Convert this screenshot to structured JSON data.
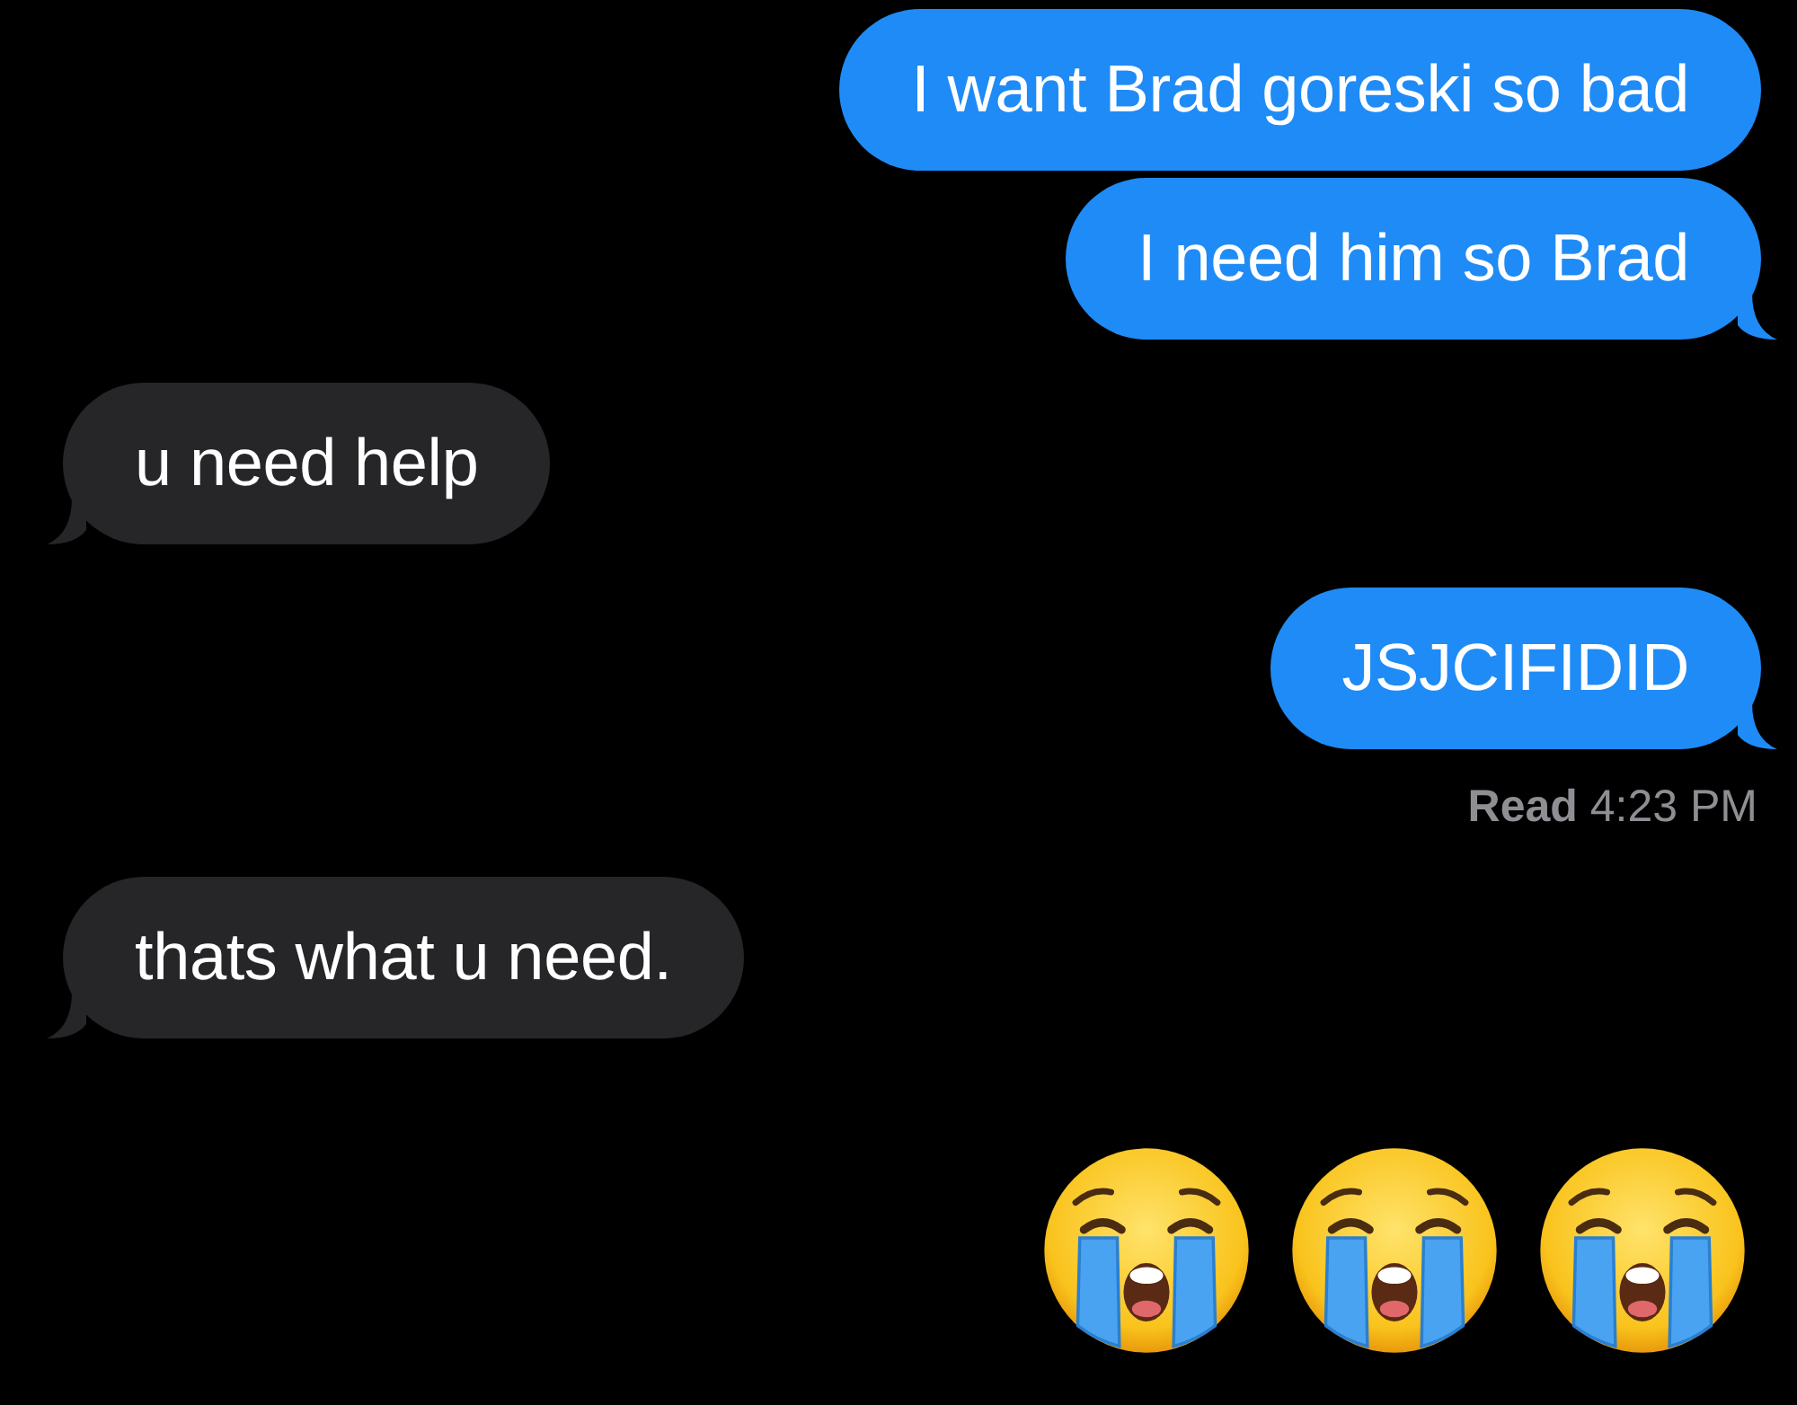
{
  "messages": [
    {
      "kind": "text",
      "sent": true,
      "text": "I want Brad goreski so bad",
      "tail": false
    },
    {
      "kind": "text",
      "sent": true,
      "text": "I need him so Brad",
      "tail": true
    },
    {
      "kind": "text",
      "sent": false,
      "text": "u need help",
      "tail": true
    },
    {
      "kind": "text",
      "sent": true,
      "text": "JSJCIFIDID",
      "tail": true
    },
    {
      "kind": "receipt",
      "status": "Read",
      "time": "4:23 PM"
    },
    {
      "kind": "text",
      "sent": false,
      "text": "thats what u need.",
      "tail": true
    },
    {
      "kind": "emoji",
      "emoji": [
        {
          "kind": "loudly_crying"
        },
        {
          "kind": "loudly_crying"
        },
        {
          "kind": "loudly_crying"
        }
      ]
    }
  ]
}
